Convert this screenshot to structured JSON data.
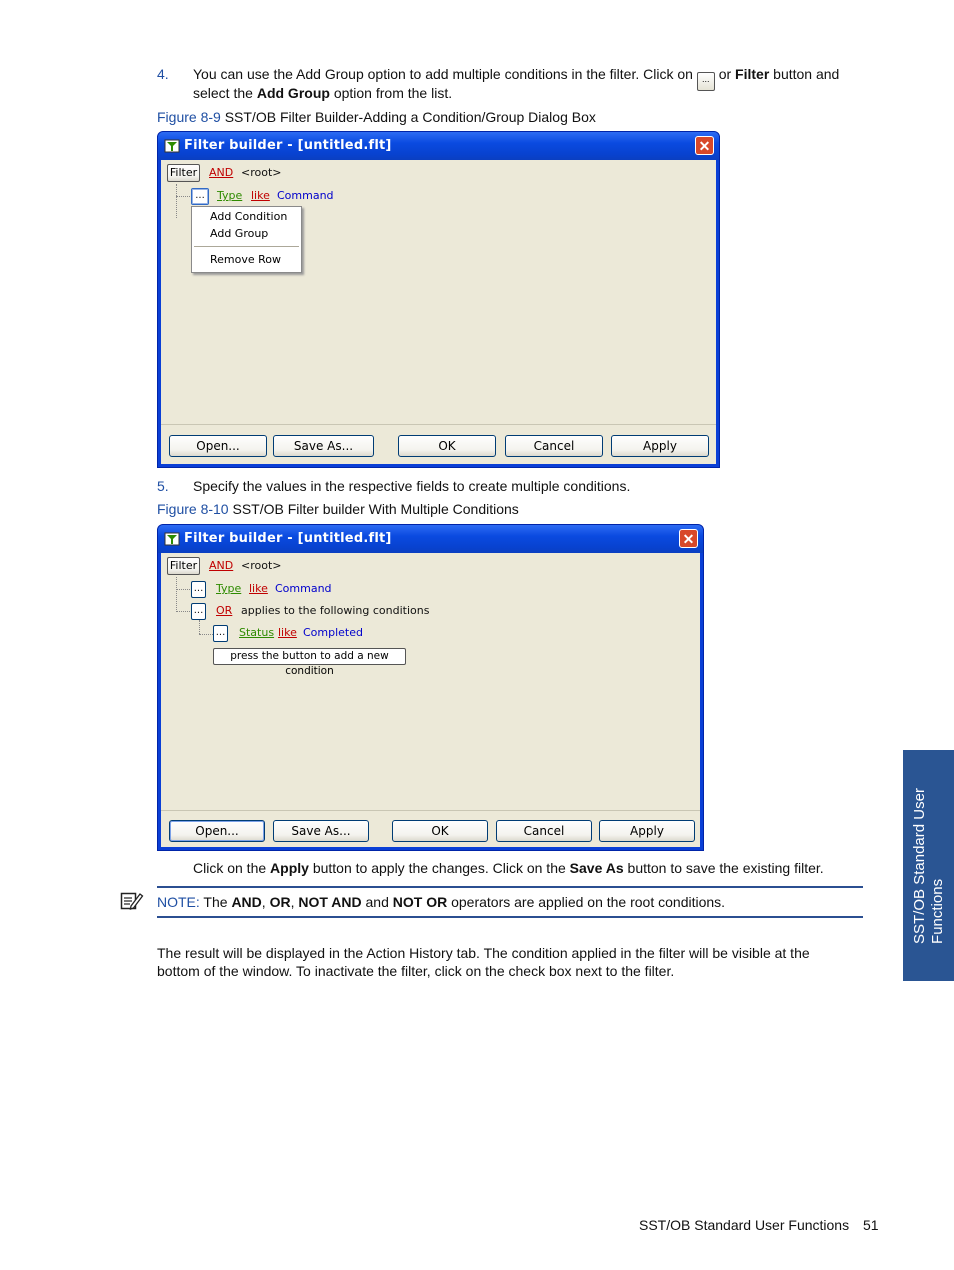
{
  "step4": {
    "number": "4.",
    "text_a": "You can use the Add Group option to add multiple conditions in the filter.  Click on",
    "text_b": "or",
    "bold_filter": "Filter",
    "text_c": "button and",
    "text_d": "select the",
    "bold_addgroup": "Add Group",
    "text_e": "option from the list."
  },
  "fig9": {
    "label": "Figure 8-9",
    "caption": "SST/OB Filter Builder-Adding a Condition/Group Dialog Box"
  },
  "dialog1": {
    "title": "Filter builder - [untitled.flt]",
    "close": "✕",
    "filter_btn": "Filter",
    "root_op": "AND",
    "root_label": "<root>",
    "row_btn": "...",
    "field": "Type",
    "operator": "like",
    "value": "Command",
    "menu": [
      "Add Condition",
      "Add Group",
      "Remove Row"
    ],
    "buttons": [
      "Open...",
      "Save As...",
      "OK",
      "Cancel",
      "Apply"
    ]
  },
  "step5": {
    "number": "5.",
    "text": "Specify the values in the respective fields to create multiple conditions."
  },
  "fig10": {
    "label": "Figure 8-10",
    "caption": "SST/OB Filter builder With Multiple Conditions"
  },
  "dialog2": {
    "title": "Filter builder - [untitled.flt]",
    "close": "✕",
    "filter_btn": "Filter",
    "root_op": "AND",
    "root_label": "<root>",
    "row_btn": "...",
    "row1": {
      "field": "Type",
      "operator": "like",
      "value": "Command"
    },
    "group_op": "OR",
    "group_text": "applies to the following conditions",
    "row2": {
      "field": "Status",
      "operator": "like",
      "value": "Completed"
    },
    "add_condition": "press the button to add a new condition",
    "buttons": [
      "Open...",
      "Save As...",
      "OK",
      "Cancel",
      "Apply"
    ]
  },
  "apply_para": {
    "a": "Click on the",
    "b_apply": "Apply",
    "c": "button to apply the changes.  Click on the",
    "d_saveas": "Save As",
    "e": "button to save the existing filter."
  },
  "note": {
    "label": "NOTE:",
    "a": "The",
    "and": "AND",
    "comma1": ",",
    "or": "OR",
    "comma2": ",",
    "notand": "NOT AND",
    "andword": "and",
    "notor": "NOT OR",
    "b": "operators are applied on the root conditions."
  },
  "result_para": {
    "line1": "The result will be displayed in the Action History tab.  The condition applied in the filter will be visible at the",
    "line2": "bottom of the window.  To inactivate the filter, click on the check box next to the filter."
  },
  "side_tab": {
    "line1": "SST/OB Standard User",
    "line2": "Functions"
  },
  "footer": {
    "title": "SST/OB Standard User Functions",
    "page": "51"
  },
  "colors": {
    "accent_blue": "#1f4fa3",
    "side_tab": "#2a5593",
    "xp_title": "#0a4ae0"
  }
}
